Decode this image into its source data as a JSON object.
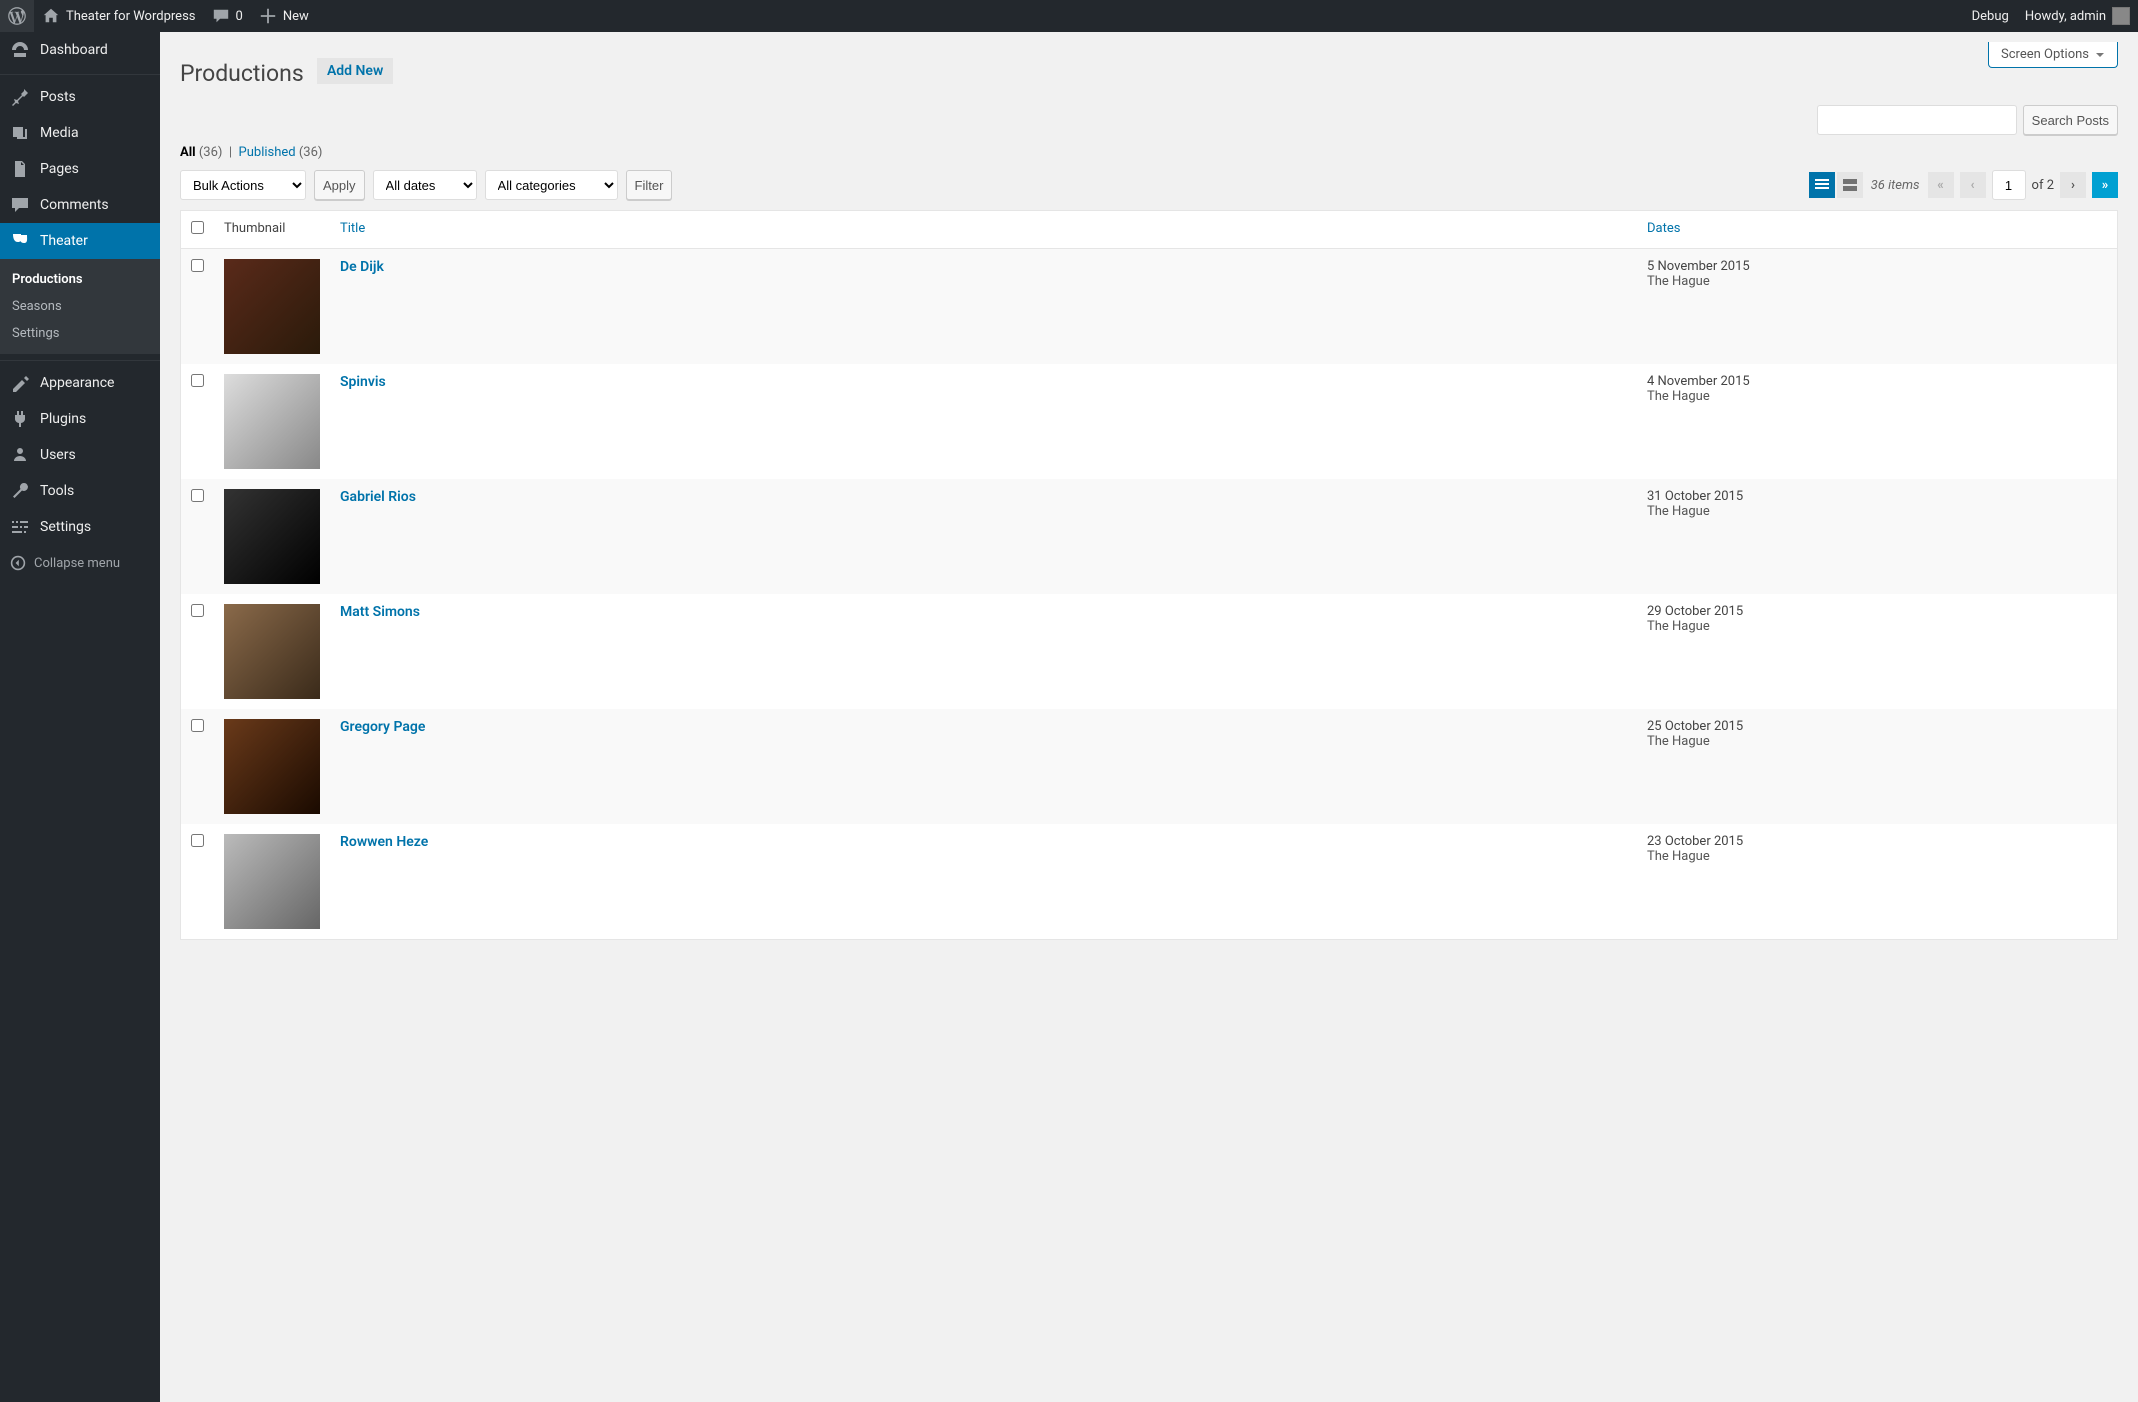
{
  "adminbar": {
    "site_title": "Theater for Wordpress",
    "comments_count": "0",
    "new_label": "New",
    "debug_label": "Debug",
    "greeting": "Howdy, admin"
  },
  "sidebar": {
    "items": [
      {
        "icon": "dashboard",
        "label": "Dashboard"
      },
      {
        "icon": "pin",
        "label": "Posts"
      },
      {
        "icon": "media",
        "label": "Media"
      },
      {
        "icon": "page",
        "label": "Pages"
      },
      {
        "icon": "comments",
        "label": "Comments"
      },
      {
        "icon": "theater",
        "label": "Theater"
      },
      {
        "icon": "appearance",
        "label": "Appearance"
      },
      {
        "icon": "plugins",
        "label": "Plugins"
      },
      {
        "icon": "users",
        "label": "Users"
      },
      {
        "icon": "tools",
        "label": "Tools"
      },
      {
        "icon": "settings",
        "label": "Settings"
      }
    ],
    "submenu": [
      {
        "label": "Productions"
      },
      {
        "label": "Seasons"
      },
      {
        "label": "Settings"
      }
    ],
    "collapse_label": "Collapse menu"
  },
  "page": {
    "screen_options": "Screen Options",
    "title": "Productions",
    "add_new": "Add New"
  },
  "filters": {
    "all_label": "All",
    "all_count": "(36)",
    "published_label": "Published",
    "published_count": "(36)",
    "bulk_actions": "Bulk Actions",
    "apply": "Apply",
    "all_dates": "All dates",
    "all_categories": "All categories",
    "filter": "Filter",
    "search_btn": "Search Posts"
  },
  "pagination": {
    "items_text": "36 items",
    "current": "1",
    "total_text": "of 2"
  },
  "table": {
    "cols": {
      "thumb": "Thumbnail",
      "title": "Title",
      "dates": "Dates"
    },
    "rows": [
      {
        "title": "De Dijk",
        "date": "5 November 2015",
        "loc": "The Hague",
        "thumb": "thumb-dedijk"
      },
      {
        "title": "Spinvis",
        "date": "4 November 2015",
        "loc": "The Hague",
        "thumb": "thumb-spinvis"
      },
      {
        "title": "Gabriel Rios",
        "date": "31 October 2015",
        "loc": "The Hague",
        "thumb": "thumb-gabriel"
      },
      {
        "title": "Matt Simons",
        "date": "29 October 2015",
        "loc": "The Hague",
        "thumb": "thumb-matt"
      },
      {
        "title": "Gregory Page",
        "date": "25 October 2015",
        "loc": "The Hague",
        "thumb": "thumb-gregory"
      },
      {
        "title": "Rowwen Heze",
        "date": "23 October 2015",
        "loc": "The Hague",
        "thumb": "thumb-rowwen"
      }
    ]
  }
}
